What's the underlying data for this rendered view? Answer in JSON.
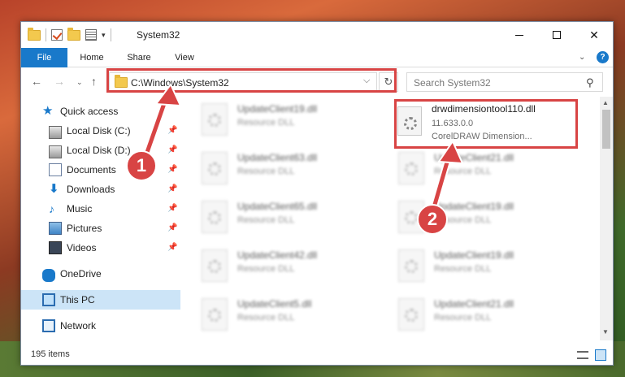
{
  "window": {
    "title": "System32",
    "minimize": "—",
    "maximize": "",
    "close": "✕"
  },
  "ribbon": {
    "tabs": [
      "File",
      "Home",
      "Share",
      "View"
    ],
    "help": "?"
  },
  "address": {
    "path": "C:\\Windows\\System32",
    "dropdown": "⌵",
    "refresh": "↻",
    "search_placeholder": "Search System32",
    "search_icon": "magnifier-icon"
  },
  "navigation": {
    "back": "←",
    "forward": "→",
    "recent": "⌄",
    "up": "↑"
  },
  "sidebar": {
    "items": [
      {
        "label": "Quick access",
        "icon": "star-icon",
        "pinned": false
      },
      {
        "label": "Local Disk (C:)",
        "icon": "disk-icon",
        "pinned": true
      },
      {
        "label": "Local Disk (D:)",
        "icon": "disk-icon",
        "pinned": true
      },
      {
        "label": "Documents",
        "icon": "documents-icon",
        "pinned": true
      },
      {
        "label": "Downloads",
        "icon": "download-icon",
        "pinned": true
      },
      {
        "label": "Music",
        "icon": "music-icon",
        "pinned": true
      },
      {
        "label": "Pictures",
        "icon": "pictures-icon",
        "pinned": true
      },
      {
        "label": "Videos",
        "icon": "videos-icon",
        "pinned": true
      },
      {
        "label": "OneDrive",
        "icon": "cloud-icon",
        "pinned": false
      },
      {
        "label": "This PC",
        "icon": "computer-icon",
        "pinned": false,
        "selected": true
      },
      {
        "label": "Network",
        "icon": "network-icon",
        "pinned": false
      }
    ],
    "pin_glyph": "📌"
  },
  "files": {
    "left_column": [
      {
        "name": "UpdateClient19.dll",
        "desc": "Resource DLL"
      },
      {
        "name": "UpdateClient63.dll",
        "desc": "Resource DLL"
      },
      {
        "name": "UpdateClient65.dll",
        "desc": "Resource DLL"
      },
      {
        "name": "UpdateClient42.dll",
        "desc": "Resource DLL"
      },
      {
        "name": "UpdateClient5.dll",
        "desc": "Resource DLL"
      }
    ],
    "highlighted": {
      "name": "drwdimensiontool110.dll",
      "version": "11.633.0.0",
      "desc": "CorelDRAW Dimension..."
    },
    "right_column": [
      {
        "name": "UpdateClient21.dll",
        "desc": "Resource DLL"
      },
      {
        "name": "UpdateClient19.dll",
        "desc": "Resource DLL"
      },
      {
        "name": "UpdateClient19.dll",
        "desc": "Resource DLL"
      },
      {
        "name": "UpdateClient21.dll",
        "desc": "Resource DLL"
      }
    ]
  },
  "status": {
    "count": "195 items"
  },
  "annotations": {
    "step1": "1",
    "step2": "2",
    "color": "#d84444"
  }
}
